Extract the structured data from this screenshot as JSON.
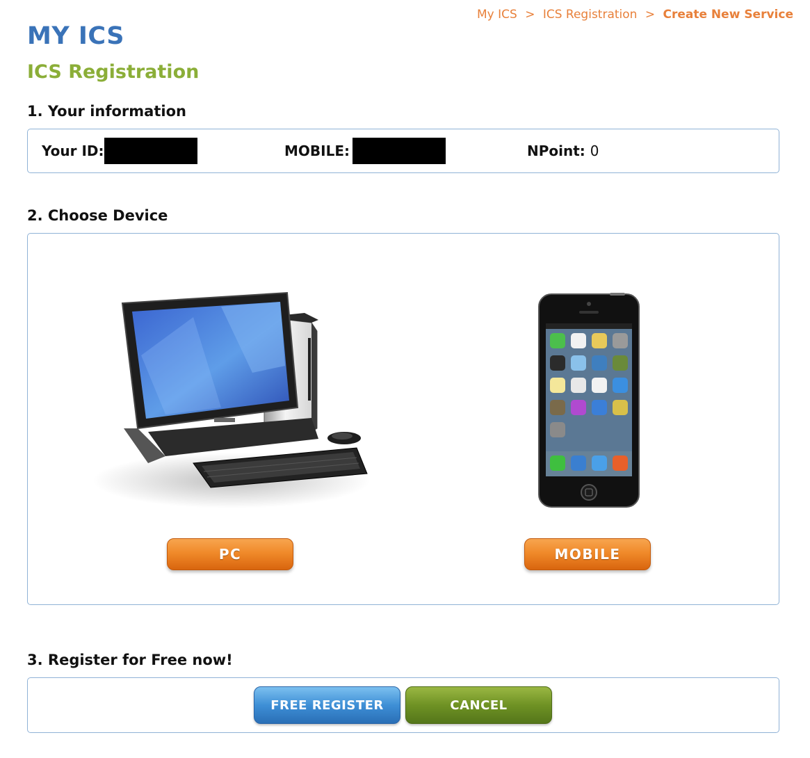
{
  "breadcrumb": {
    "items": [
      "My ICS",
      "ICS Registration"
    ],
    "current": "Create New Service",
    "separator": ">"
  },
  "app_title": "MY ICS",
  "page_title": "ICS Registration",
  "sections": {
    "info": {
      "heading": "1. Your information",
      "id_label": "Your ID:",
      "mobile_label": "MOBILE:",
      "npoint_label": "NPoint:",
      "npoint_value": "0"
    },
    "device": {
      "heading": "2. Choose Device",
      "pc_label": "PC",
      "mobile_label": "MOBILE"
    },
    "register": {
      "heading": "3. Register for Free now!",
      "register_label": "FREE REGISTER",
      "cancel_label": "CANCEL"
    }
  },
  "colors": {
    "brand_blue": "#3a73b8",
    "title_green": "#8bae38",
    "breadcrumb_orange": "#e8803a",
    "box_border": "#8fb2d6"
  }
}
